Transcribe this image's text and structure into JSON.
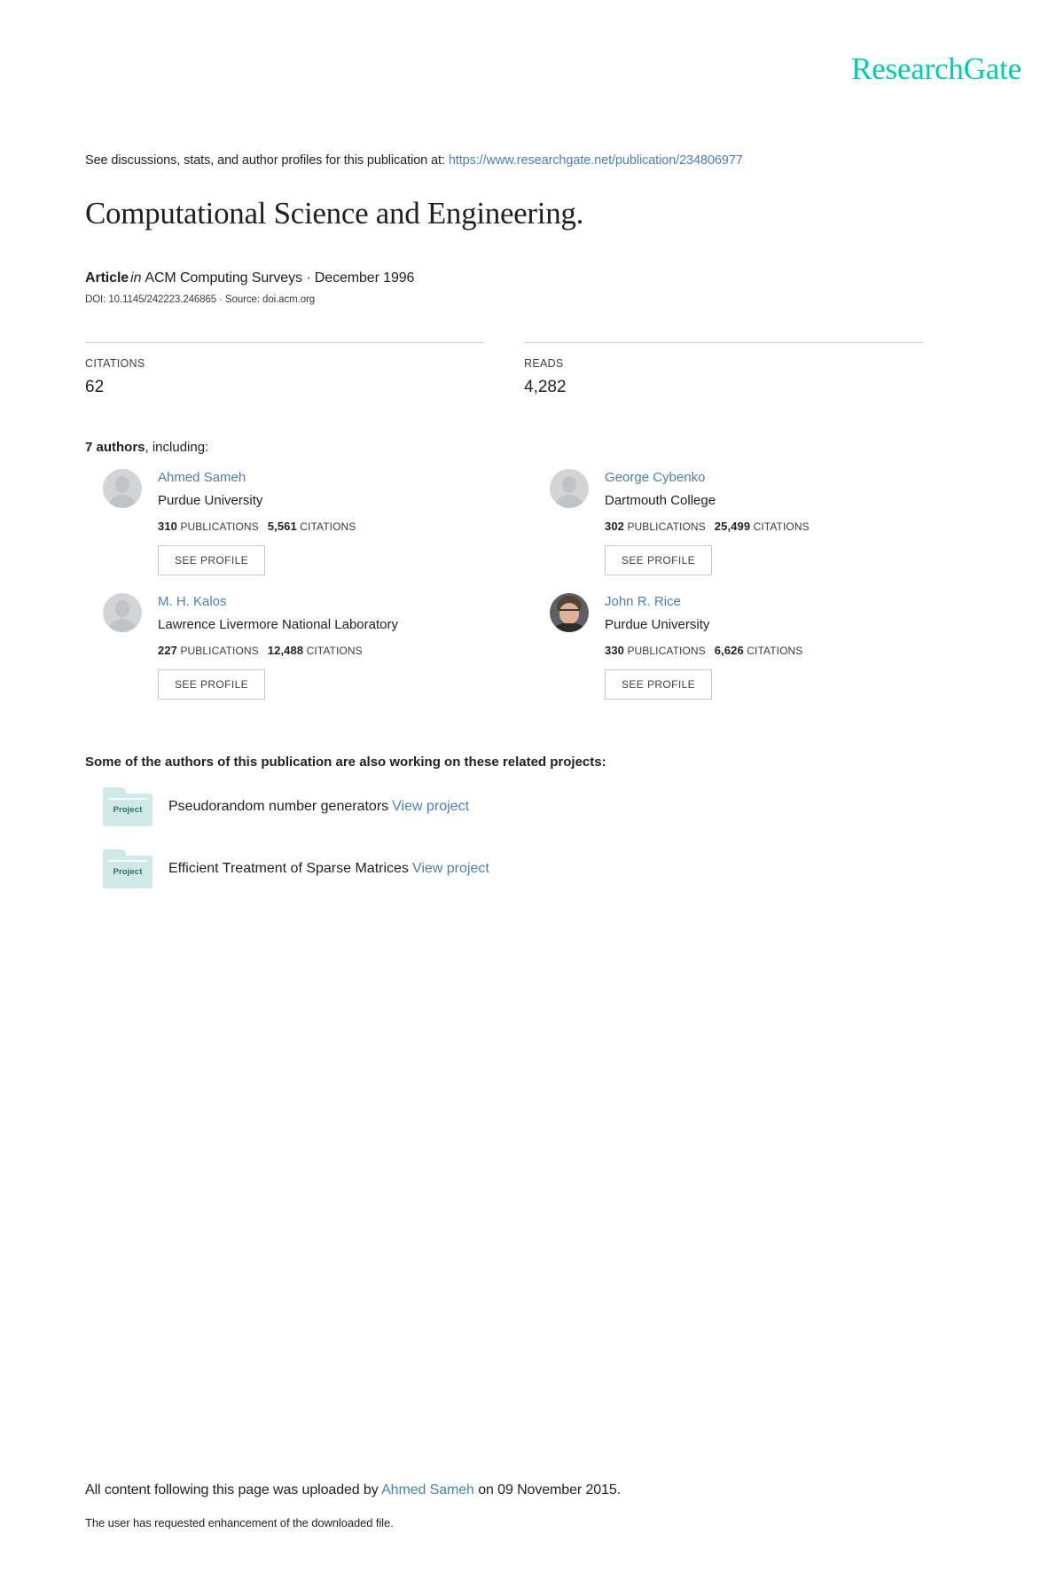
{
  "brand": {
    "logo_text": "ResearchGate",
    "logo_color": "#00ccb1",
    "link_color": "#4a7eb5"
  },
  "header": {
    "see_discussions_prefix": "See discussions, stats, and author profiles for this publication at:",
    "publication_url": "https://www.researchgate.net/publication/234806977"
  },
  "publication": {
    "title": "Computational Science and Engineering.",
    "type_label": "Article",
    "in_label": "in",
    "venue_and_date": "ACM Computing Surveys · December 1996",
    "doi_line": "DOI: 10.1145/242223.246865 · Source: doi.acm.org"
  },
  "stats": [
    {
      "label": "CITATIONS",
      "value": "62"
    },
    {
      "label": "READS",
      "value": "4,282"
    }
  ],
  "authors_section": {
    "count_label": "7 authors",
    "including_label": ", including:",
    "see_profile_label": "SEE PROFILE",
    "publications_label": "PUBLICATIONS",
    "citations_label": "CITATIONS",
    "authors": [
      {
        "name": "Ahmed Sameh",
        "affiliation": "Purdue University",
        "publications": "310",
        "citations": "5,561",
        "avatar": "placeholder"
      },
      {
        "name": "George Cybenko",
        "affiliation": "Dartmouth College",
        "publications": "302",
        "citations": "25,499",
        "avatar": "placeholder"
      },
      {
        "name": "M. H. Kalos",
        "affiliation": "Lawrence Livermore National Laboratory",
        "publications": "227",
        "citations": "12,488",
        "avatar": "placeholder"
      },
      {
        "name": "John R. Rice",
        "affiliation": "Purdue University",
        "publications": "330",
        "citations": "6,626",
        "avatar": "photo"
      }
    ]
  },
  "projects_section": {
    "heading": "Some of the authors of this publication are also working on these related projects:",
    "folder_badge_label": "Project",
    "view_project_label": "View project",
    "projects": [
      {
        "title": "Pseudorandom number generators"
      },
      {
        "title": "Efficient Treatment of Sparse Matrices"
      }
    ]
  },
  "footer": {
    "upload_prefix": "All content following this page was uploaded by",
    "uploader": "Ahmed Sameh",
    "upload_suffix": "on 09 November 2015.",
    "enhancement_note": "The user has requested enhancement of the downloaded file."
  }
}
